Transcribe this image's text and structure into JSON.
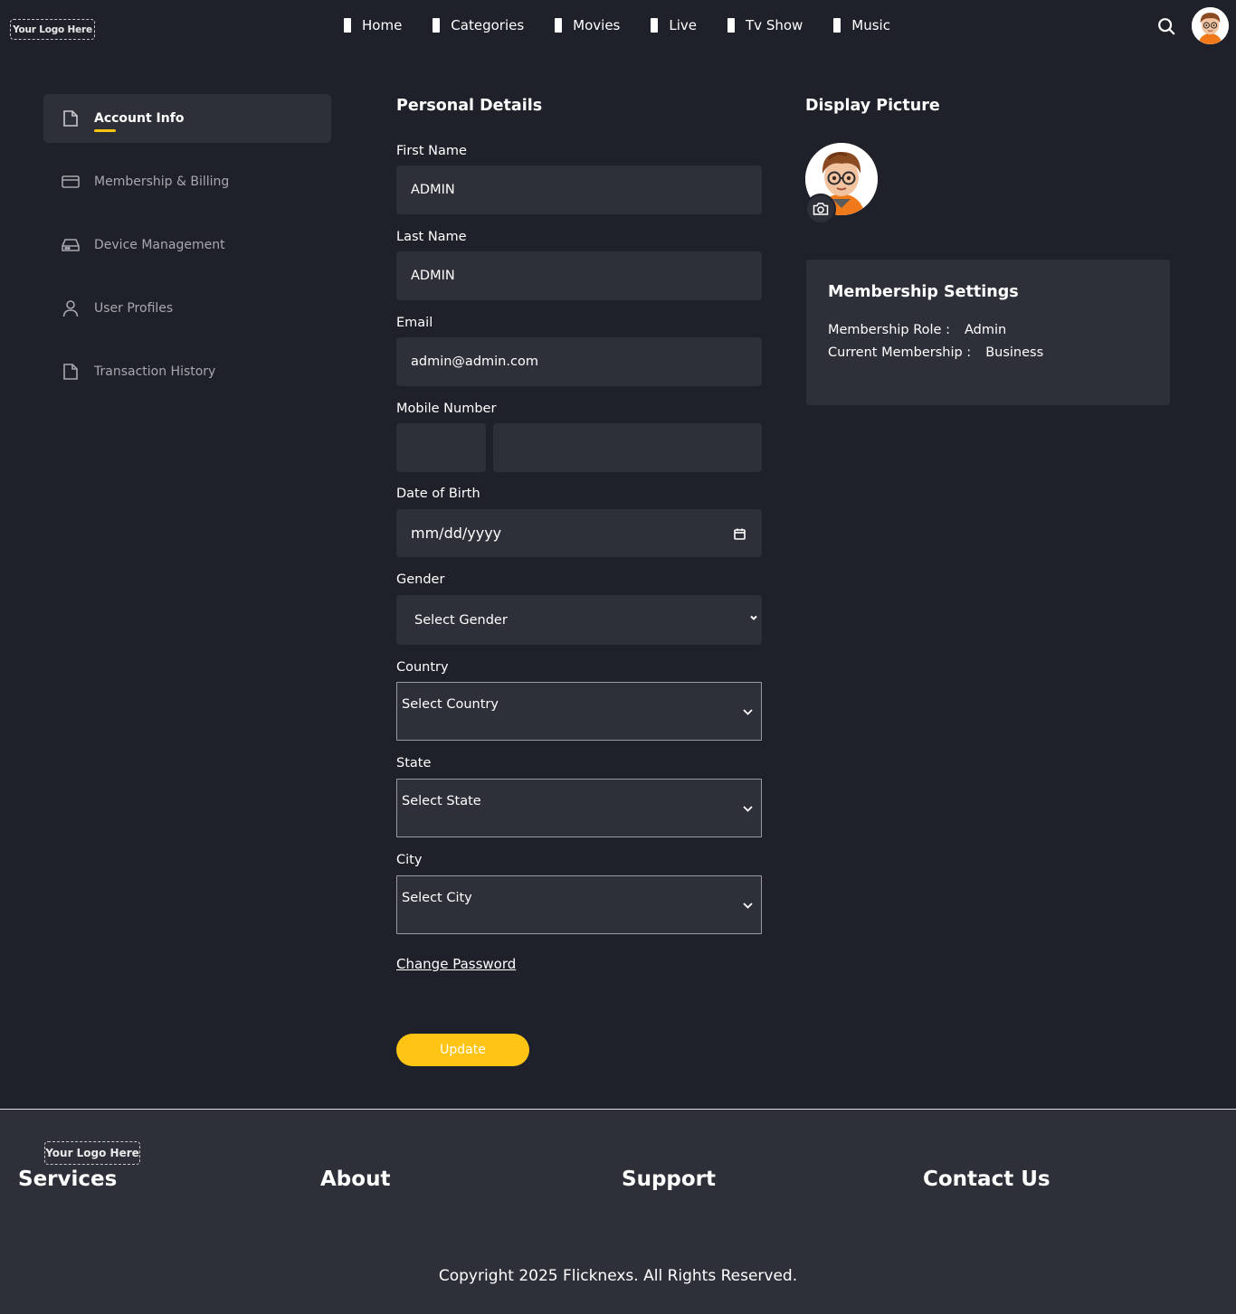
{
  "header": {
    "logo_text": "Your Logo Here",
    "nav": [
      "Home",
      "Categories",
      "Movies",
      "Live",
      "Tv Show",
      "Music"
    ]
  },
  "sidebar": {
    "items": [
      {
        "label": "Account Info",
        "icon": "file-icon",
        "active": true
      },
      {
        "label": "Membership & Billing",
        "icon": "credit-card-icon",
        "active": false
      },
      {
        "label": "Device Management",
        "icon": "hard-drive-icon",
        "active": false
      },
      {
        "label": "User Profiles",
        "icon": "user-icon",
        "active": false
      },
      {
        "label": "Transaction History",
        "icon": "file-icon",
        "active": false
      }
    ]
  },
  "personal": {
    "title": "Personal Details",
    "first_name": {
      "label": "First Name",
      "value": "ADMIN"
    },
    "last_name": {
      "label": "Last Name",
      "value": "ADMIN"
    },
    "email": {
      "label": "Email",
      "value": "admin@admin.com"
    },
    "mobile": {
      "label": "Mobile Number",
      "code": "",
      "number": ""
    },
    "dob": {
      "label": "Date of Birth",
      "placeholder": "mm/dd/yyyy"
    },
    "gender": {
      "label": "Gender",
      "value": "Select Gender"
    },
    "country": {
      "label": "Country",
      "value": "Select Country"
    },
    "state": {
      "label": "State",
      "value": "Select State"
    },
    "city": {
      "label": "City",
      "value": "Select City"
    },
    "change_password": "Change Password",
    "update": "Update"
  },
  "display": {
    "title": "Display Picture"
  },
  "membership": {
    "title": "Membership Settings",
    "role_label": "Membership Role :",
    "role_value": "Admin",
    "current_label": "Current Membership :",
    "current_value": "Business"
  },
  "footer": {
    "logo_text": "Your Logo Here",
    "columns": [
      "Services",
      "About",
      "Support",
      "Contact Us"
    ],
    "copyright": "Copyright 2025 Flicknexs. All Rights Reserved."
  },
  "colors": {
    "background": "#1f212a",
    "surface": "#2e3039",
    "accent": "#ffc414",
    "muted_text": "#a7a8ad"
  }
}
